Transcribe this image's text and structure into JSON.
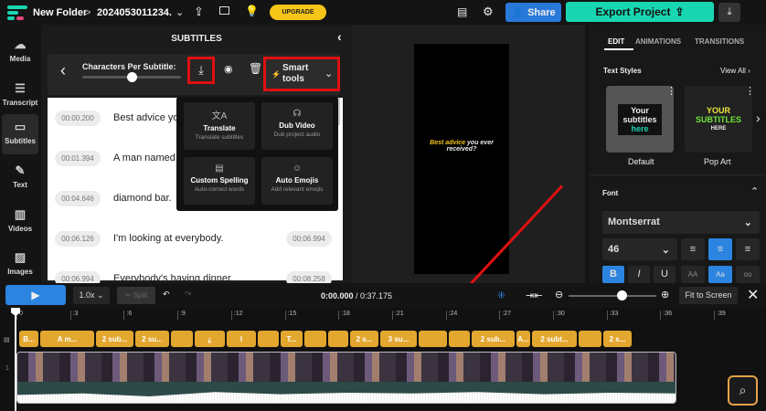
{
  "header": {
    "folder": "New Folder",
    "separator": ">",
    "project": "2024053011234.",
    "upgrade": "UPGRADE",
    "share": "Share",
    "export": "Export Project"
  },
  "sidebar": [
    {
      "label": "Media",
      "icon": "upload-cloud-icon"
    },
    {
      "label": "Transcript",
      "icon": "transcript-icon"
    },
    {
      "label": "Subtitles",
      "icon": "subtitles-icon"
    },
    {
      "label": "Text",
      "icon": "text-edit-icon"
    },
    {
      "label": "Videos",
      "icon": "film-icon"
    },
    {
      "label": "Images",
      "icon": "image-icon"
    }
  ],
  "subtitles": {
    "title": "SUBTITLES",
    "chars_label": "Characters Per Subtitle:",
    "chars_slider": 0.5,
    "smart_tools": "Smart tools",
    "rows": [
      {
        "start": "00:00.200",
        "text": "Best advice yo",
        "end": ""
      },
      {
        "start": "00:01.394",
        "text": "A man named",
        "end": ""
      },
      {
        "start": "00:04.646",
        "text": "diamond bar.",
        "end": ""
      },
      {
        "start": "00:06.126",
        "text": "I'm looking at everybody.",
        "end": "00:06.994"
      },
      {
        "start": "00:06.994",
        "text": "Everybody's having dinner,",
        "end": "00:08.258"
      }
    ],
    "menu": [
      {
        "title": "Translate",
        "sub": "Translate subtitles",
        "icon": "translate-icon",
        "g": "文A"
      },
      {
        "title": "Dub Video",
        "sub": "Dub project audio",
        "icon": "voice-icon",
        "g": "☊"
      },
      {
        "title": "Custom Spelling",
        "sub": "Auto-correct words",
        "icon": "book-icon",
        "g": "▤"
      },
      {
        "title": "Auto Emojis",
        "sub": "Add relevant emojis",
        "icon": "smiley-icon",
        "g": "☺"
      }
    ]
  },
  "preview": {
    "caption_bold": "Best advice",
    "caption_rest": " you ever received?"
  },
  "right": {
    "tabs": [
      "EDIT",
      "ANIMATIONS",
      "TRANSITIONS"
    ],
    "text_styles": "Text Styles",
    "view_all": "View All ›",
    "styles": [
      {
        "name": "Default",
        "l1": "Your",
        "l2": "subtitles",
        "l3": "here"
      },
      {
        "name": "Pop Art",
        "l1": "YOUR",
        "l2": "SUBTITLES",
        "l3": "HERE"
      }
    ],
    "font_label": "Font",
    "font": "Montserrat",
    "size": "46",
    "b": "B",
    "i": "I",
    "u": "U",
    "aa": "AA",
    "Aa": "Aa",
    "oo": "oo"
  },
  "timeline": {
    "speed": "1.0x",
    "split": "Split",
    "time": "0:00.000",
    "total": " / 0:37.175",
    "fit": "Fit to Screen",
    "zoom_level": 0.6,
    "ticks": [
      "0",
      ":3",
      ":6",
      ":9",
      ":12",
      ":15",
      ":18",
      ":21",
      ":24",
      ":27",
      ":30",
      ":33",
      ":36",
      ":39"
    ],
    "clips": [
      "B...",
      "A m...",
      "2 sub...",
      "2 su...",
      "",
      "¿",
      "I",
      "",
      "T...",
      "",
      "",
      "2 s...",
      "3 su...",
      "",
      "",
      "2 sub...",
      "A...",
      "2 subt...",
      "",
      "2 s..."
    ],
    "track": "1"
  }
}
